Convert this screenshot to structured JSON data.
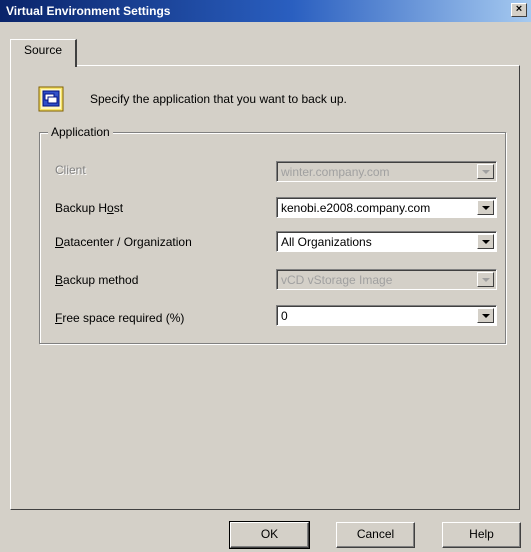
{
  "window": {
    "title": "Virtual Environment Settings",
    "close_glyph": "×"
  },
  "tabs": [
    {
      "label": "Source",
      "selected": true
    }
  ],
  "intro": {
    "icon": "application-window-icon",
    "text": "Specify the application that you want to back up."
  },
  "group": {
    "legend": "Application",
    "fields": [
      {
        "label": "Client",
        "value": "winter.company.com",
        "enabled": false
      },
      {
        "label_pre": "Backup H",
        "label_u": "o",
        "label_post": "st",
        "value": "kenobi.e2008.company.com",
        "enabled": true
      },
      {
        "label_pre": "",
        "label_u": "D",
        "label_post": "atacenter / Organization",
        "value": "All Organizations",
        "enabled": true
      },
      {
        "label_pre": "",
        "label_u": "B",
        "label_post": "ackup method",
        "value": "vCD vStorage Image",
        "enabled": false
      },
      {
        "label_pre": "",
        "label_u": "F",
        "label_post": "ree space required (%)",
        "value": "0",
        "enabled": true
      }
    ]
  },
  "buttons": {
    "ok": "OK",
    "cancel": "Cancel",
    "help": "Help"
  }
}
